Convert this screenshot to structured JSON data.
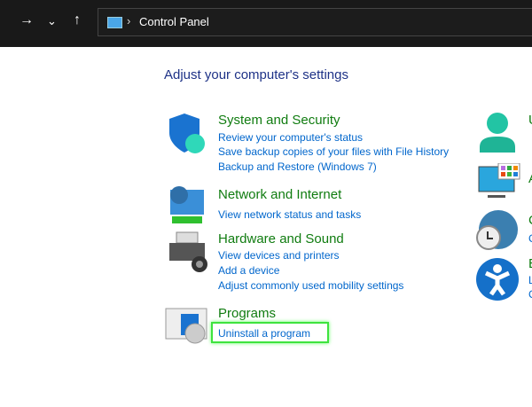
{
  "toolbar": {
    "forward": "→",
    "recent": "⌄",
    "up": "↑",
    "separator": "›",
    "location": "Control Panel"
  },
  "heading": "Adjust your computer's settings",
  "categories": [
    {
      "title": "System and Security",
      "links": [
        "Review your computer's status",
        "Save backup copies of your files with File History",
        "Backup and Restore (Windows 7)"
      ]
    },
    {
      "title": "Network and Internet",
      "links": [
        "View network status and tasks"
      ]
    },
    {
      "title": "Hardware and Sound",
      "links": [
        "View devices and printers",
        "Add a device",
        "Adjust commonly used mobility settings"
      ]
    },
    {
      "title": "Programs",
      "links": [
        "Uninstall a program"
      ]
    }
  ],
  "right": {
    "user_accounts": "U",
    "appearance": "A",
    "clock": "C",
    "clock_link": "C",
    "ease": "E",
    "ease_link1": "L",
    "ease_link2": "C"
  }
}
